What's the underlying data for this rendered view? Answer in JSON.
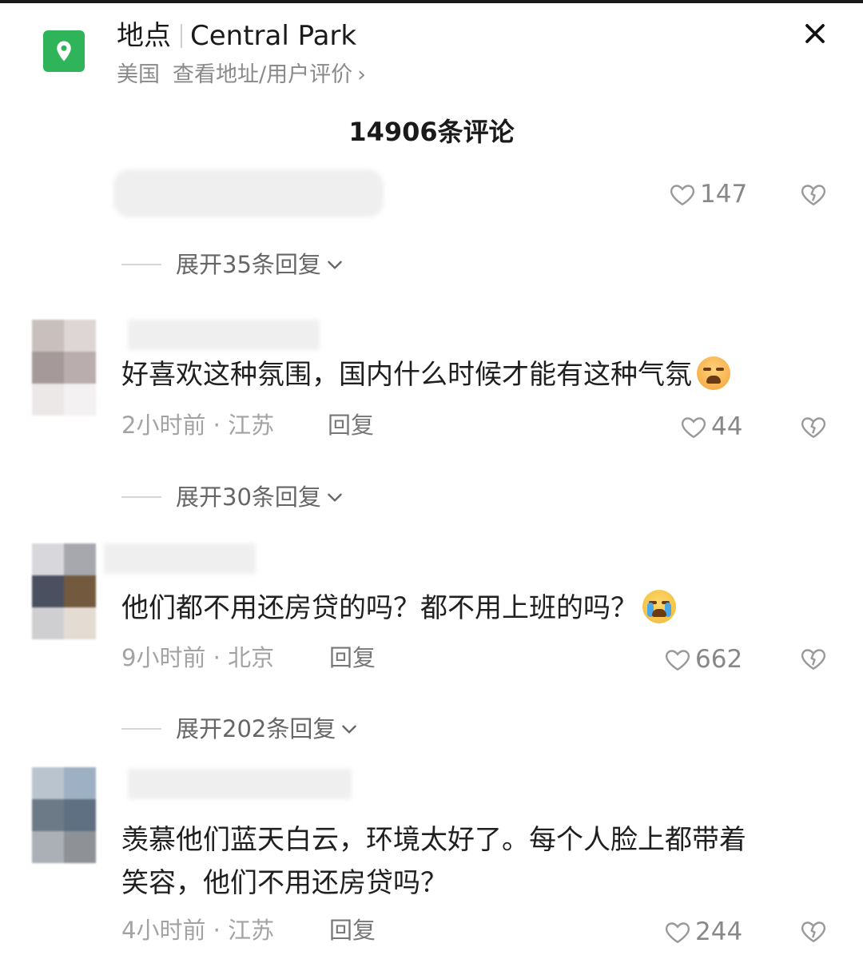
{
  "header": {
    "label": "地点",
    "place": "Central Park",
    "country": "美国",
    "link": "查看地址/用户评价",
    "link_chevron": "›",
    "close_icon": "close-icon",
    "location_icon": "location-pin-icon",
    "brand_color": "#2fb45a"
  },
  "comments_count": "14906条评论",
  "first_comment": {
    "likes": "147"
  },
  "comments": [
    {
      "expand_label": "展开35条回复",
      "text": "好喜欢这种氛围，国内什么时候才能有这种气氛",
      "emoji": "tired-face-emoji",
      "meta": "2小时前 · 江苏",
      "reply_label": "回复",
      "likes": "44"
    },
    {
      "expand_label": "展开30条回复",
      "text": "他们都不用还房贷的吗？都不用上班的吗？",
      "emoji": "crying-face-emoji",
      "meta": "9小时前 · 北京",
      "reply_label": "回复",
      "likes": "662"
    },
    {
      "expand_label": "展开202条回复",
      "text_line1": "羡慕他们蓝天白云，环境太好了。每个人脸上都带着",
      "text_line2": "笑容，他们不用还房贷吗？",
      "meta": "4小时前 · 江苏",
      "reply_label": "回复",
      "likes": "244"
    }
  ]
}
